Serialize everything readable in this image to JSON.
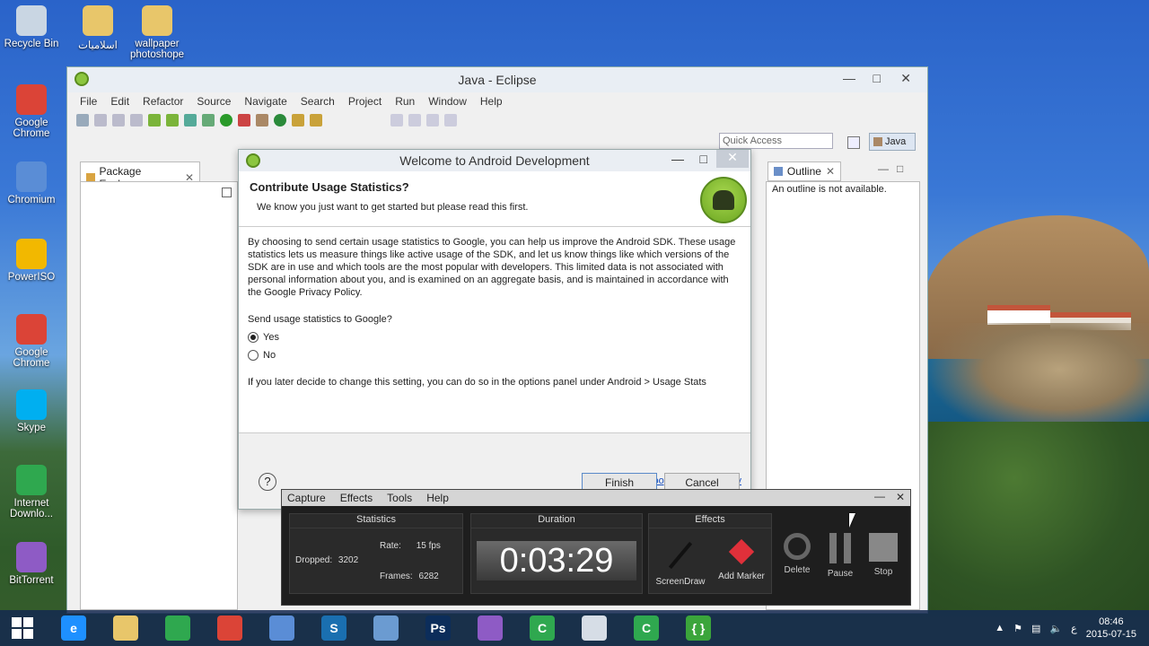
{
  "desktop": {
    "icons": [
      {
        "label": "Recycle Bin",
        "icon": "recycle-bin-icon",
        "color": "#c9d6e3"
      },
      {
        "label": "اسلاميات",
        "icon": "folder-icon",
        "color": "#e8c66a"
      },
      {
        "label": "wallpaper photoshope",
        "icon": "folder-icon",
        "color": "#e8c66a"
      },
      {
        "label": "Google Chrome",
        "icon": "chrome-icon",
        "color": "#db4437"
      },
      {
        "label": "Chromium",
        "icon": "chromium-icon",
        "color": "#5a8dd6"
      },
      {
        "label": "PowerISO",
        "icon": "poweriso-icon",
        "color": "#f2b800"
      },
      {
        "label": "Google Chrome",
        "icon": "chrome-icon",
        "color": "#db4437"
      },
      {
        "label": "Skype",
        "icon": "skype-icon",
        "color": "#00aff0"
      },
      {
        "label": "Internet Downlo...",
        "icon": "idm-icon",
        "color": "#2fa84f"
      },
      {
        "label": "BitTorrent",
        "icon": "bittorrent-icon",
        "color": "#8e5bc5"
      }
    ]
  },
  "eclipse": {
    "title": "Java - Eclipse",
    "menu": [
      "File",
      "Edit",
      "Refactor",
      "Source",
      "Navigate",
      "Search",
      "Project",
      "Run",
      "Window",
      "Help"
    ],
    "quick_access_placeholder": "Quick Access",
    "perspective": "Java",
    "package_explorer": "Package Explorer",
    "outline": "Outline",
    "outline_msg": "An outline is not available."
  },
  "dialog": {
    "title": "Welcome to Android Development",
    "heading": "Contribute Usage Statistics?",
    "subheading": "We know you just want to get started but please read this first.",
    "body": "By choosing to send certain usage statistics to Google, you can help us improve the Android SDK. These usage statistics lets us measure things like active usage of the SDK, and let us know things like which versions of the SDK are in use and which tools are the most popular with developers. This limited data is not associated with personal information about you, and is examined on an aggregate basis, and is maintained in accordance with the Google Privacy Policy.",
    "question": "Send usage statistics to Google?",
    "option_yes": "Yes",
    "option_no": "No",
    "selected": "Yes",
    "later_note": "If you later decide to change this setting, you can do so in the options panel under Android > Usage Stats",
    "privacy_link": "Google Privacy Policy",
    "finish": "Finish",
    "cancel": "Cancel"
  },
  "recorder": {
    "menu": [
      "Capture",
      "Effects",
      "Tools",
      "Help"
    ],
    "statistics_label": "Statistics",
    "dropped_label": "Dropped:",
    "dropped_value": "3202",
    "rate_label": "Rate:",
    "rate_value": "15 fps",
    "frames_label": "Frames:",
    "frames_value": "6282",
    "duration_label": "Duration",
    "duration_value": "0:03:29",
    "effects_label": "Effects",
    "screendraw": "ScreenDraw",
    "add_marker": "Add Marker",
    "delete": "Delete",
    "pause": "Pause",
    "stop": "Stop"
  },
  "taskbar": {
    "apps": [
      {
        "icon": "internet-explorer-icon",
        "color": "#1e90ff",
        "glyph": "e"
      },
      {
        "icon": "file-explorer-icon",
        "color": "#e8c66a",
        "glyph": ""
      },
      {
        "icon": "store-icon",
        "color": "#2fa84f",
        "glyph": ""
      },
      {
        "icon": "chrome-icon",
        "color": "#db4437",
        "glyph": ""
      },
      {
        "icon": "chromium-icon",
        "color": "#5a8dd6",
        "glyph": ""
      },
      {
        "icon": "camtasia-icon",
        "color": "#1a6fb0",
        "glyph": "S"
      },
      {
        "icon": "paint-icon",
        "color": "#6b9bd1",
        "glyph": ""
      },
      {
        "icon": "photoshop-icon",
        "color": "#0c2d5a",
        "glyph": "Ps"
      },
      {
        "icon": "bittorrent-icon",
        "color": "#8e5bc5",
        "glyph": ""
      },
      {
        "icon": "camtasia-recorder-icon",
        "color": "#2fa84f",
        "glyph": "C"
      },
      {
        "icon": "window-icon",
        "color": "#d6dde6",
        "glyph": ""
      },
      {
        "icon": "camtasia-recorder-icon",
        "color": "#2fa84f",
        "glyph": "C"
      },
      {
        "icon": "android-eclipse-icon",
        "color": "#3ba53b",
        "glyph": "{ }"
      }
    ],
    "lang": "ع",
    "time": "08:46",
    "date": "2015-07-15"
  }
}
